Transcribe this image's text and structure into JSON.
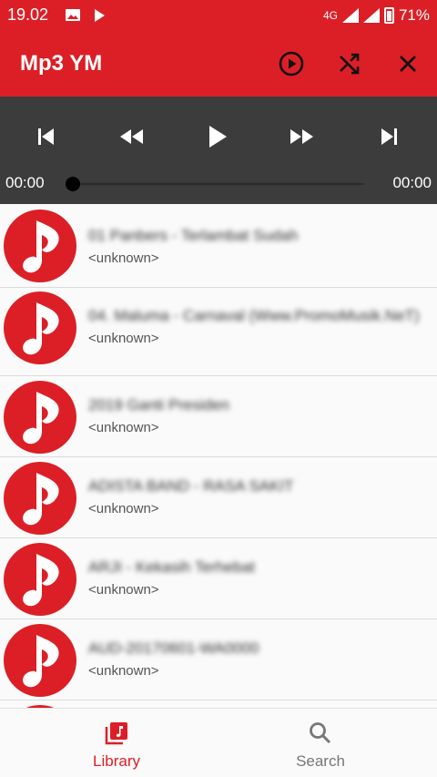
{
  "status_bar": {
    "time": "19.02",
    "network": "4G",
    "battery": "71%",
    "icons": [
      "image-icon",
      "play-icon",
      "signal-icon",
      "battery-icon"
    ]
  },
  "toolbar": {
    "title": "Mp3 YM",
    "actions": [
      "play-circle-icon",
      "shuffle-icon",
      "close-icon"
    ],
    "color": "#dc1f26"
  },
  "player": {
    "current_time": "00:00",
    "total_time": "00:00",
    "progress": 0,
    "controls": [
      "skip-previous-icon",
      "rewind-icon",
      "play-icon",
      "fast-forward-icon",
      "skip-next-icon"
    ]
  },
  "songs": [
    {
      "title": "01 Panbers - Terlambat Sudah",
      "artist": "<unknown>"
    },
    {
      "title": "04. Maluma - Carnaval (Www.PromoMusik.NeT)",
      "artist": "<unknown>"
    },
    {
      "title": "2019 Ganti Presiden",
      "artist": "<unknown>"
    },
    {
      "title": "ADISTA BAND - RASA SAKIT",
      "artist": "<unknown>"
    },
    {
      "title": "ARJI - Kekasih Terhebat",
      "artist": "<unknown>"
    },
    {
      "title": "AUD-20170601-WA0000",
      "artist": "<unknown>"
    }
  ],
  "bottom_nav": {
    "library": "Library",
    "search": "Search",
    "active": "library",
    "active_color": "#dc1f26",
    "inactive_color": "#777777"
  }
}
